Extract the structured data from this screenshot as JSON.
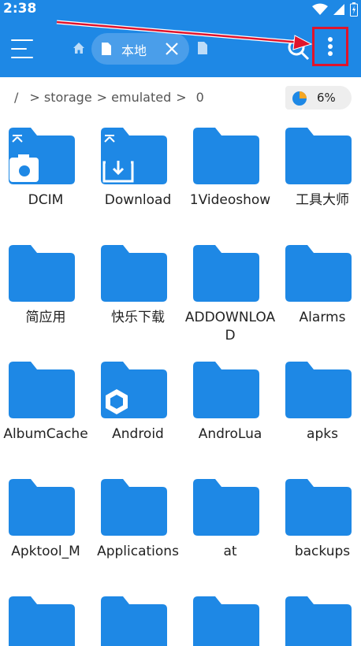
{
  "status": {
    "time": "2:38"
  },
  "appbar": {
    "tab_label": "本地"
  },
  "path": {
    "root": "/",
    "segments": [
      "> storage",
      "> emulated",
      ">",
      "0"
    ]
  },
  "storage": {
    "percent": "6%"
  },
  "colors": {
    "accent": "#1e88e5",
    "folder": "#1e88e5",
    "highlight": "#e0142c"
  },
  "folders": [
    {
      "name": "DCIM",
      "badge": "camera"
    },
    {
      "name": "Download",
      "badge": "download"
    },
    {
      "name": "1Videoshow",
      "badge": ""
    },
    {
      "name": "工具大师",
      "badge": ""
    },
    {
      "name": "简应用",
      "badge": ""
    },
    {
      "name": "快乐下载",
      "badge": ""
    },
    {
      "name": "ADDOWNLOAD",
      "badge": ""
    },
    {
      "name": "Alarms",
      "badge": ""
    },
    {
      "name": "AlbumCache",
      "badge": ""
    },
    {
      "name": "Android",
      "badge": "hexagon"
    },
    {
      "name": "AndroLua",
      "badge": ""
    },
    {
      "name": "apks",
      "badge": ""
    },
    {
      "name": "Apktool_M",
      "badge": ""
    },
    {
      "name": "Applications",
      "badge": ""
    },
    {
      "name": "at",
      "badge": ""
    },
    {
      "name": "backups",
      "badge": ""
    },
    {
      "name": "",
      "badge": ""
    },
    {
      "name": "",
      "badge": ""
    },
    {
      "name": "",
      "badge": ""
    },
    {
      "name": "",
      "badge": ""
    }
  ]
}
